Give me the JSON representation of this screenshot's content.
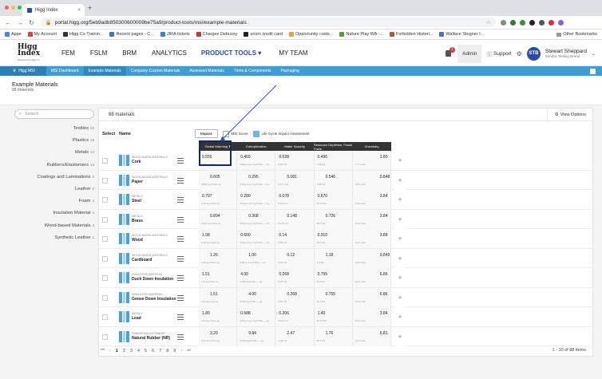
{
  "browser": {
    "tab_title": "Higg Index",
    "tab_close": "×",
    "new_tab": "+",
    "url": "portal.higg.org/5eb9adb850300600009be75a9/product-tools/msi/example-materials",
    "bookmarks": [
      {
        "label": "Apps",
        "color": "#4285f4"
      },
      {
        "label": "My Account",
        "color": "#d44"
      },
      {
        "label": "Higg Co Trainin...",
        "color": "#333"
      },
      {
        "label": "Recent pages - C...",
        "color": "#3a76c9"
      },
      {
        "label": "JIRA tickets",
        "color": "#2684ff"
      },
      {
        "label": "Chargex Debussy",
        "color": "#c33"
      },
      {
        "label": "union credit card",
        "color": "#222"
      },
      {
        "label": "Opportunity costs...",
        "color": "#e9a23b"
      },
      {
        "label": "Nature Play WA -...",
        "color": "#5a9b3a"
      },
      {
        "label": "Forbidden Histori...",
        "color": "#b53"
      },
      {
        "label": "Wallace Stegner I...",
        "color": "#4a76b9"
      }
    ],
    "other_bookmarks": "Other Bookmarks"
  },
  "header": {
    "logo_line1": "Higg",
    "logo_line2": "Index",
    "logo_tagline": "Powered by Higg Co",
    "nav": [
      {
        "label": "FEM",
        "active": false
      },
      {
        "label": "FSLM",
        "active": false
      },
      {
        "label": "BRM",
        "active": false
      },
      {
        "label": "ANALYTICS",
        "active": false
      },
      {
        "label": "PRODUCT TOOLS ▾",
        "active": true
      },
      {
        "label": "MY TEAM",
        "active": false
      }
    ],
    "notif_count": "1",
    "admin_label": "Admin",
    "support_label": "Support",
    "avatar_initials": "STB",
    "user_name": "Stewart Sheppard",
    "user_org": "Sondra Testing Brand"
  },
  "subnav": {
    "home_label": "Higg MSI",
    "items": [
      {
        "label": "MSI Dashboard",
        "active": false
      },
      {
        "label": "Example Materials",
        "active": true
      },
      {
        "label": "Company Custom Materials",
        "active": false
      },
      {
        "label": "Assessed Materials",
        "active": false
      },
      {
        "label": "Trims & Components",
        "active": false
      },
      {
        "label": "Packaging",
        "active": false
      }
    ]
  },
  "page": {
    "title": "Example Materials",
    "subtitle": "88 Materials"
  },
  "sidebar": {
    "search_placeholder": "Search",
    "categories": [
      {
        "label": "Textiles",
        "count": "22"
      },
      {
        "label": "Plastics",
        "count": "19"
      },
      {
        "label": "Metals",
        "count": "14"
      },
      {
        "label": "Rubbers/Elastomers",
        "count": "13"
      },
      {
        "label": "Coatings and Laminations",
        "count": "6"
      },
      {
        "label": "Leather",
        "count": "5"
      },
      {
        "label": "Foam",
        "count": "4"
      },
      {
        "label": "Insulation Material",
        "count": "4"
      },
      {
        "label": "Wood-based Materials",
        "count": "4"
      },
      {
        "label": "Synthetic Leather",
        "count": "1"
      }
    ]
  },
  "main": {
    "count_label": "88 materials",
    "view_options": "View Options",
    "col_select": "Select",
    "col_name": "Name",
    "toggle_impact": "Impact",
    "toggle_msi": "MSI Score",
    "toggle_lca": "Life Cycle Impact Assessment",
    "impact_columns": [
      "Global Warming ⬆",
      "Eutrophication",
      "Water Scarcity",
      "Resource Depletion, Fossil Fuels",
      "Chemistry"
    ],
    "rows": [
      {
        "category": "Wood-based materials",
        "name": "Cork",
        "values": [
          "0.555",
          "0.469",
          "0.028",
          "0.496",
          "1.80"
        ],
        "units": [
          "1.18 kg CO2e eq",
          "0.20g w.eq / kg PO4e — eq",
          "0.56 m3",
          "7.02 MJ",
          "1.77 units"
        ]
      },
      {
        "category": "Wood-based materials",
        "name": "Paper",
        "values": [
          "0.605",
          "0.295",
          "0.081",
          "0.546",
          "0.848"
        ],
        "units": [
          "0.851 kg CO2e eq",
          "0.24g w.eq / kg PO4e — eq",
          "0.177 m3",
          "1.88 MJ",
          "0.96 units"
        ]
      },
      {
        "category": "Metals",
        "name": "Steel",
        "values": [
          "0.797",
          "0.280",
          "0.078",
          "0.670",
          "3.84"
        ],
        "units": [
          "2.49 kg CO2e eq",
          "0.51g w.eq / kg PO4e — eq",
          "0.115 m3",
          "22.67 MJ",
          "4.99 units"
        ]
      },
      {
        "category": "Metals",
        "name": "Brass",
        "values": [
          "0.894",
          "0.368",
          "0.148",
          "0.726",
          "3.84"
        ],
        "units": [
          "4.047 kg CO2e eq",
          "0.51g w.eq / kg PO4e — eq",
          "0.115 m3",
          "38.7 MJ",
          "4.99 units"
        ]
      },
      {
        "category": "Wood-based materials",
        "name": "Wood",
        "values": [
          "1.08",
          "0.600",
          "0.14",
          "0.910",
          "3.88"
        ],
        "units": [
          "1.18 kg CO2e eq",
          "0.20g w.eq / kg PO4e — eq",
          "0.55 m3",
          "19.7 MJ",
          "0.21 units"
        ]
      },
      {
        "category": "Wood-based materials",
        "name": "Cardboard",
        "values": [
          "1.26",
          "1.00",
          "0.12",
          "1.18",
          "0.849"
        ],
        "units": [
          "1.39 kg CO2e eq",
          "0.987e-4 kg PO4e — eq",
          "0.96 m3",
          "6.4 MJ",
          "0.96 units"
        ]
      },
      {
        "category": "Insulation Material",
        "name": "Duck Down Insulation",
        "values": [
          "1.51",
          "4.00",
          "0.268",
          "0.755",
          "6.86"
        ],
        "units": [
          "1.61 kg CO2 eq",
          "0.094 kg PO4e — eq",
          "0.97 m3",
          "11.5 MJ",
          "14.5 units"
        ]
      },
      {
        "category": "Insulation Material",
        "name": "Goose Down Insulation",
        "values": [
          "1.51",
          "4.00",
          "0.268",
          "0.755",
          "6.86"
        ],
        "units": [
          "1.61 kg CO2 eq",
          "0.094 kg PO4e — eq",
          "0.97 m3",
          "11.5 MJ",
          "14.5 units"
        ]
      },
      {
        "category": "Metals",
        "name": "Lead",
        "values": [
          "1.80",
          "0.588",
          "0.206",
          "1.40",
          "3.84"
        ],
        "units": [
          "1.61 kg CO2e eq",
          "0.51g w.eq / kg PO4e — eq",
          "0.115 m3",
          "36.07 MJ",
          "4.99 units"
        ]
      },
      {
        "category": "Rubbers/Elastomers",
        "name": "Natural Rubber (NR)",
        "values": [
          "3.29",
          "9.84",
          "2.47",
          "1.76",
          "5.81"
        ],
        "units": [
          "2.32 kg CO2e eq",
          "0.055g kg PO4e — eq",
          "2.25 m3",
          "25.7 MJ",
          "12.0 units"
        ]
      }
    ],
    "pager": {
      "first": "⏮",
      "prev": "‹",
      "pages": [
        "1",
        "2",
        "3",
        "4",
        "5",
        "6",
        "7",
        "8",
        "9"
      ],
      "next": "›",
      "last": "⏭",
      "range": "1 - 10 of 88 items"
    }
  },
  "colors": {
    "accent": "#3a9fd6",
    "brand_blue": "#2b4ba8",
    "highlight_box": "#13276a"
  }
}
